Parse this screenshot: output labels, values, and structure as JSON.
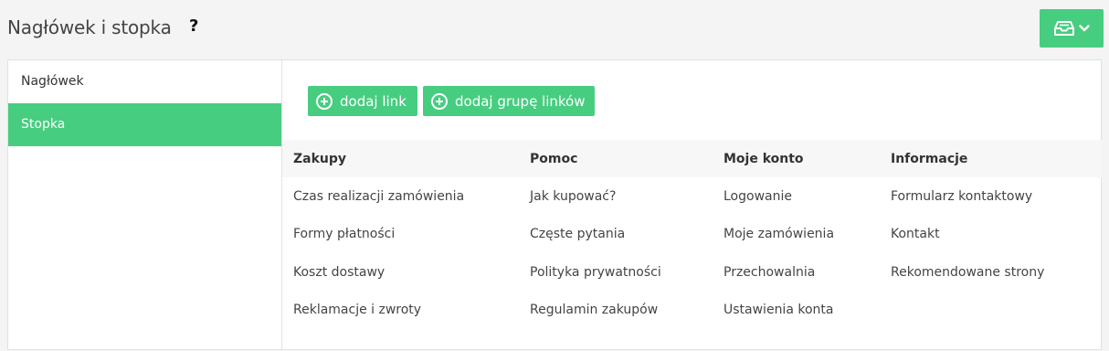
{
  "header": {
    "title": "Nagłówek i stopka",
    "help": "?"
  },
  "icons": {
    "save": "inbox-tray-icon",
    "dropdown": "chevron-down-icon",
    "add": "plus-circle-icon"
  },
  "colors": {
    "accent": "#47cd80",
    "background": "#f4f4f4"
  },
  "sidebar": {
    "items": [
      {
        "label": "Nagłówek",
        "active": false
      },
      {
        "label": "Stopka",
        "active": true
      }
    ]
  },
  "toolbar": {
    "add_link_label": "dodaj link",
    "add_group_label": "dodaj grupę linków"
  },
  "table": {
    "columns": [
      "Zakupy",
      "Pomoc",
      "Moje konto",
      "Informacje"
    ],
    "rows": [
      [
        "Czas realizacji zamówienia",
        "Jak kupować?",
        "Logowanie",
        "Formularz kontaktowy"
      ],
      [
        "Formy płatności",
        "Częste pytania",
        "Moje zamówienia",
        "Kontakt"
      ],
      [
        "Koszt dostawy",
        "Polityka prywatności",
        "Przechowalnia",
        "Rekomendowane strony"
      ],
      [
        "Reklamacje i zwroty",
        "Regulamin zakupów",
        "Ustawienia konta",
        ""
      ]
    ]
  }
}
